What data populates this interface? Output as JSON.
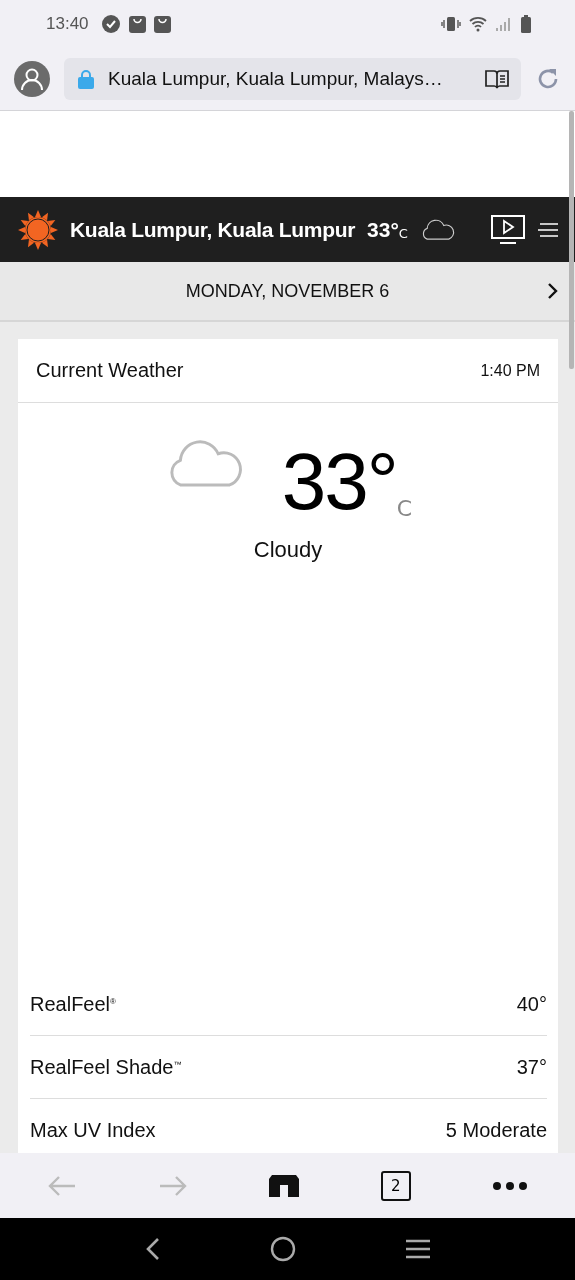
{
  "status_bar": {
    "time": "13:40"
  },
  "browser": {
    "url": "Kuala Lumpur, Kuala Lumpur, Malays…",
    "tab_count": "2"
  },
  "header": {
    "location": "Kuala Lumpur, Kuala Lumpur",
    "temp": "33°",
    "unit": "C"
  },
  "date_bar": {
    "date": "MONDAY, NOVEMBER 6"
  },
  "current": {
    "title": "Current Weather",
    "time": "1:40 PM",
    "temp": "33°",
    "unit": "C",
    "condition": "Cloudy"
  },
  "details": [
    {
      "label": "RealFeel$^{®}$",
      "value": "40°"
    },
    {
      "label": "RealFeel Shade$^{™}$",
      "value": "37°"
    },
    {
      "label": "Max UV Index",
      "value": "5 Moderate"
    }
  ]
}
